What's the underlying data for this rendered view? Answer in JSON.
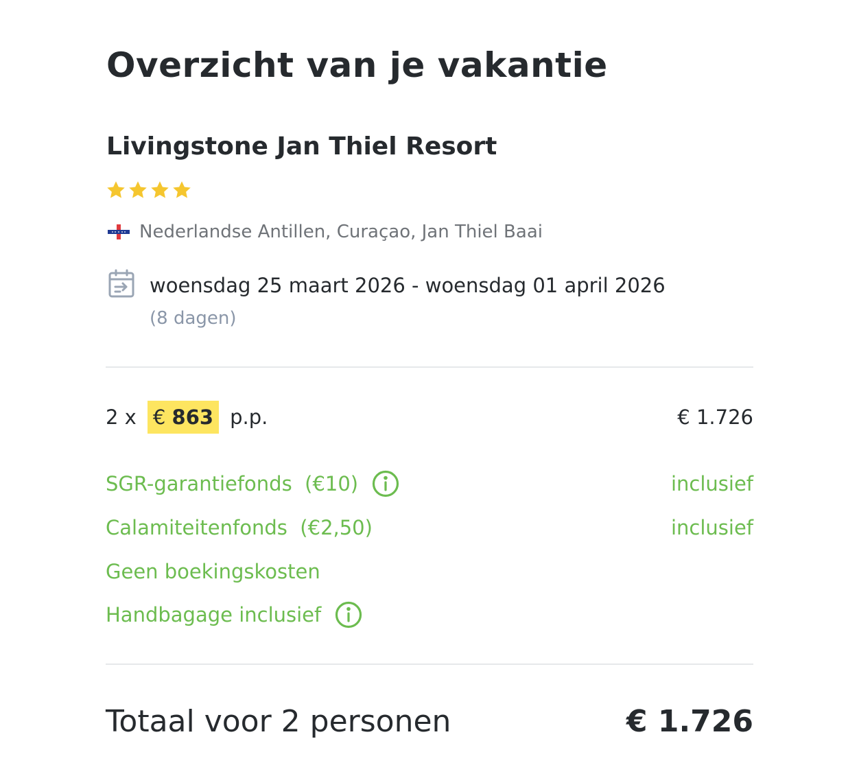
{
  "page": {
    "title": "Overzicht van je vakantie"
  },
  "hotel": {
    "name": "Livingstone Jan Thiel Resort",
    "stars": 4,
    "star_color": "#f5c62f",
    "location": "Nederlandse Antillen, Curaçao, Jan Thiel Baai",
    "flag_icon": "netherlands-antilles-flag-icon"
  },
  "dates": {
    "icon": "calendar-icon",
    "range": "woensdag 25 maart 2026 - woensdag 01 april 2026",
    "duration": "(8 dagen)"
  },
  "pricing": {
    "quantity": "2 x",
    "currency": "€",
    "per_person_amount": "863",
    "per_person_suffix": "p.p.",
    "subtotal": "€ 1.726",
    "highlight_color": "#fde560"
  },
  "fees": [
    {
      "label": "SGR-garantiefonds  (€10)",
      "value": "inclusief",
      "has_info": true
    },
    {
      "label": "Calamiteitenfonds  (€2,50)",
      "value": "inclusief",
      "has_info": false
    },
    {
      "label": "Geen boekingskosten",
      "value": "",
      "has_info": false
    },
    {
      "label": "Handbagage inclusief",
      "value": "",
      "has_info": true
    }
  ],
  "fee_color": "#6cbc4f",
  "total": {
    "label": "Totaal voor 2 personen",
    "value": "€ 1.726"
  }
}
